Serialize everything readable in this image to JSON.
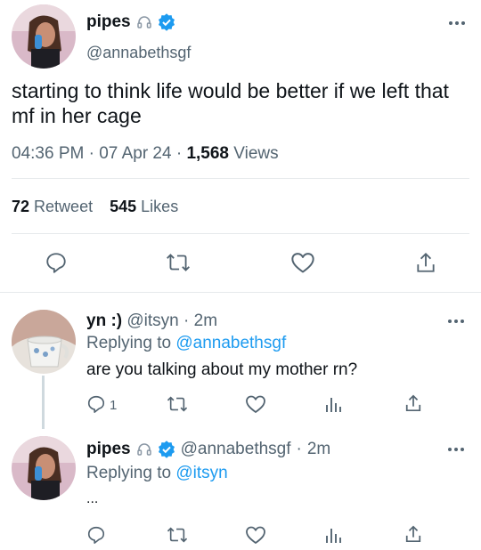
{
  "main_tweet": {
    "display_name": "pipes",
    "handle": "@annabethsgf",
    "text": "starting to think life would be better if we left that mf in her cage",
    "time": "04:36 PM",
    "sep": "·",
    "date": "07 Apr 24",
    "views_count": "1,568",
    "views_label": "Views",
    "retweet_count": "72",
    "retweet_label": "Retweet",
    "likes_count": "545",
    "likes_label": "Likes"
  },
  "replies": [
    {
      "display_name": "yn :)",
      "handle": "@itsyn",
      "dot": "·",
      "time_ago": "2m",
      "replying_prefix": "Replying to",
      "replying_to": "@annabethsgf",
      "text": "are you talking about my mother rn?",
      "reply_count": "1"
    },
    {
      "display_name": "pipes",
      "handle": "@annabethsgf",
      "dot": "·",
      "time_ago": "2m",
      "replying_prefix": "Replying to",
      "replying_to": "@itsyn",
      "text": "..."
    }
  ],
  "colors": {
    "accent": "#1d9bf0",
    "muted": "#536471",
    "text": "#0f1419",
    "divider": "#e6e9ec"
  }
}
